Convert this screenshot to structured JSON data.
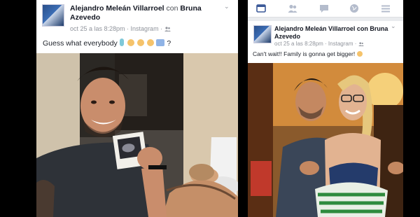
{
  "left_post": {
    "author": "Alejandro Meleán Villarroel",
    "with_word": "con",
    "tagged": "Bruna",
    "tagged_line2": "Azevedo",
    "meta": "oct 25 a las 8:28pm · Instagram · ",
    "caption_text": "Guess what everybody ",
    "caption_end": "?",
    "menu_glyph": "⌄"
  },
  "right_post": {
    "author": "Alejandro Meleán Villarroel con Bruna",
    "tagged_line2": "Azevedo",
    "meta": "oct 25 a las 8:28pm · Instagram · ",
    "caption": "Can't wait!! Family is gonna get bigger! ",
    "menu_glyph": "⌄"
  },
  "nav": {
    "items": [
      "news-feed-icon",
      "friends-icon",
      "messages-icon",
      "globe-icon",
      "menu-icon"
    ],
    "active_color": "#3b5998",
    "inactive_color": "#b4bccc"
  }
}
